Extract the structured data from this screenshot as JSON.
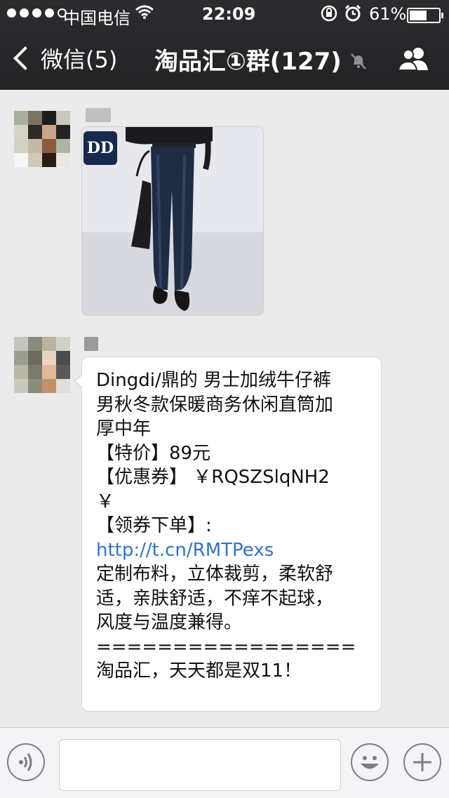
{
  "status_bar": {
    "carrier": "中国电信",
    "time": "22:09",
    "battery": "61%",
    "battery_level": 0.61
  },
  "nav": {
    "back_label": "微信(5)",
    "title": "淘品汇①群(127)"
  },
  "messages": [
    {
      "type": "image",
      "sender": "",
      "image_logo": "DD"
    },
    {
      "type": "text",
      "sender": "",
      "lines": [
        "Dingdi/鼎的 男士加绒牛仔裤",
        "男秋冬款保暖商务休闲直筒加",
        "厚中年",
        "【特价】89元",
        "【优惠券】 ￥RQSZSlqNH2",
        "￥",
        "【领券下单】:",
        "http://t.cn/RMTPexs",
        "定制布料，立体裁剪，柔软舒",
        "适，亲肤舒适，不痒不起球，",
        "风度与温度兼得。",
        "=================",
        "淘品汇，天天都是双11！"
      ]
    }
  ],
  "input_bar": {
    "input_value": ""
  },
  "icons": {
    "wifi": "wifi-icon",
    "lock": "rotation-lock-icon",
    "alarm": "alarm-icon",
    "mute": "mute-icon",
    "group": "group-members-icon",
    "voice": "voice-icon",
    "emoji": "emoji-icon",
    "plus": "plus-icon"
  },
  "colors": {
    "nav_bg": "#2c2c30",
    "chat_bg": "#ebebeb",
    "link": "#2e74d0"
  }
}
